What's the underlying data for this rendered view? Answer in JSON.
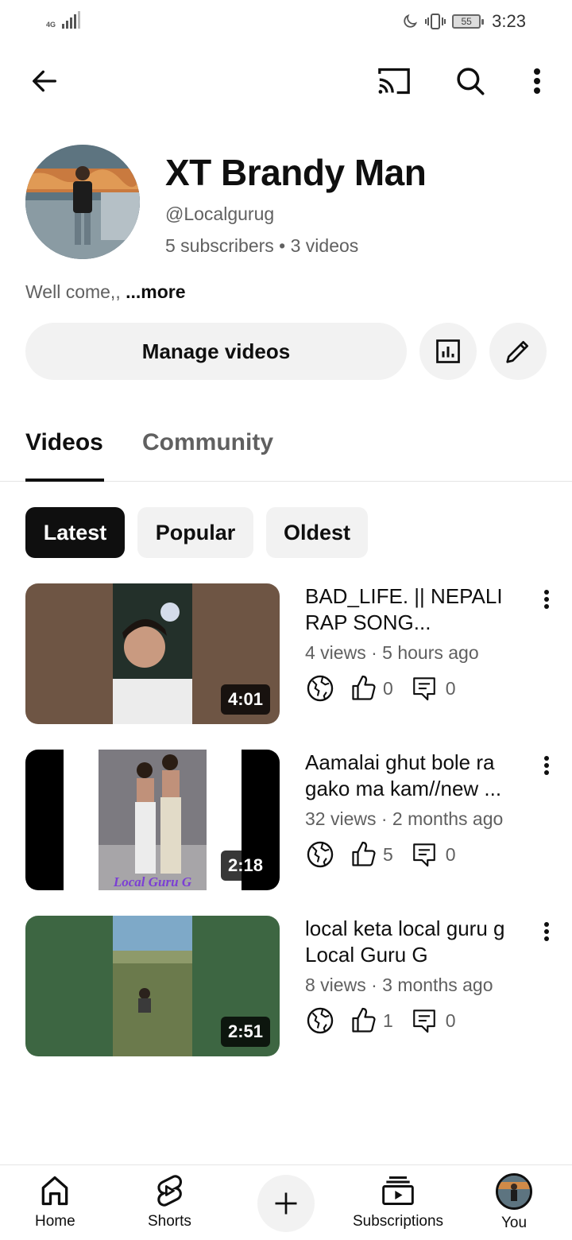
{
  "status_bar": {
    "network": "4G",
    "battery": "55",
    "time": "3:23"
  },
  "top_bar": {
    "icons": [
      "back-arrow-icon",
      "cast-icon",
      "search-icon",
      "more-vert-icon"
    ]
  },
  "channel": {
    "name": "XT Brandy Man",
    "handle": "@Localgurug",
    "meta": "5 subscribers • 3 videos",
    "description": "Well come,, ",
    "more_label": "...more"
  },
  "actions": {
    "manage_label": "Manage videos"
  },
  "tabs": [
    {
      "label": "Videos",
      "active": true
    },
    {
      "label": "Community",
      "active": false
    }
  ],
  "chips": [
    {
      "label": "Latest",
      "selected": true
    },
    {
      "label": "Popular",
      "selected": false
    },
    {
      "label": "Oldest",
      "selected": false
    }
  ],
  "videos": [
    {
      "title": "BAD_LIFE.  ||  NEPALI RAP SONG...",
      "meta": "4 views · 5 hours ago",
      "duration": "4:01",
      "likes": "0",
      "comments": "0"
    },
    {
      "title": "Aamalai ghut bole ra gako ma kam//new ...",
      "meta": "32 views · 2 months ago",
      "duration": "2:18",
      "thumb_caption": "Local Guru G",
      "likes": "5",
      "comments": "0"
    },
    {
      "title": "local keta local guru g Local Guru G",
      "meta": "8 views · 3 months ago",
      "duration": "2:51",
      "likes": "1",
      "comments": "0"
    }
  ],
  "bottom_nav": {
    "home": "Home",
    "shorts": "Shorts",
    "subscriptions": "Subscriptions",
    "you": "You"
  },
  "colors": {
    "text": "#0f0f0f",
    "secondary": "#606060",
    "chip_bg": "#f2f2f2"
  }
}
